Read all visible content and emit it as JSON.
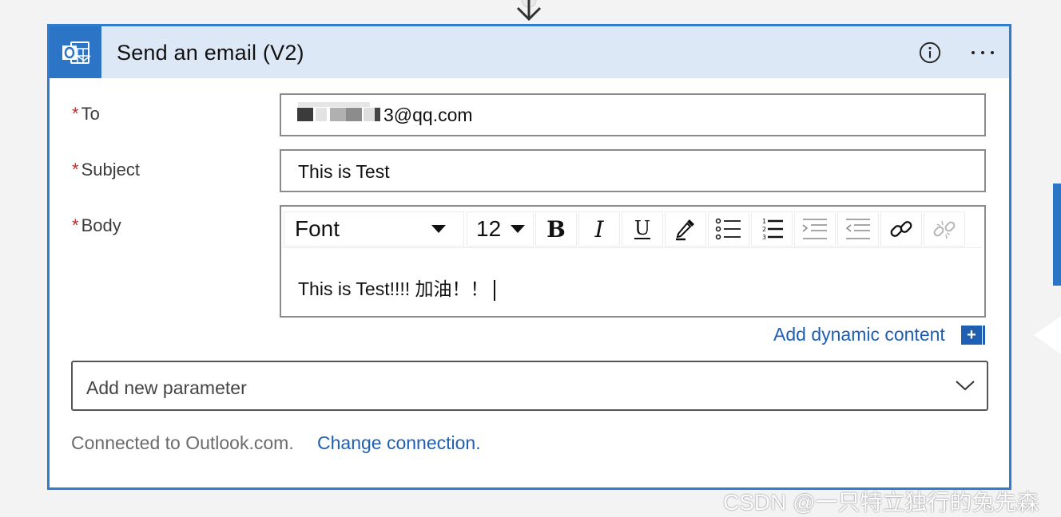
{
  "flow": {
    "connector_icon": "down-arrow-icon"
  },
  "action_card": {
    "title": "Send an email (V2)",
    "app_icon": "outlook-icon",
    "info_icon": "info-icon",
    "more_icon": "more-options-icon",
    "accent_color": "#2b74c6",
    "header_bg": "#dde8f6"
  },
  "fields": {
    "to": {
      "required_mark": "*",
      "label": "To",
      "value_visible": "3@qq.com",
      "redacted": true
    },
    "subject": {
      "required_mark": "*",
      "label": "Subject",
      "value": "This is Test"
    },
    "body": {
      "required_mark": "*",
      "label": "Body",
      "content": "This is Test!!!! 加油！！"
    }
  },
  "editor_toolbar": {
    "font_label": "Font",
    "size_label": "12",
    "buttons": [
      "bold-icon",
      "italic-icon",
      "underline-icon",
      "color-picker-icon",
      "bulleted-list-icon",
      "numbered-list-icon",
      "decrease-indent-icon",
      "increase-indent-icon",
      "insert-link-icon",
      "remove-link-icon"
    ]
  },
  "dynamic_content": {
    "label": "Add dynamic content",
    "plus": "+"
  },
  "parameter": {
    "placeholder": "Add new parameter"
  },
  "connection": {
    "text": "Connected to Outlook.com.",
    "link": "Change connection."
  },
  "watermark": "CSDN @一只特立独行的兔先森"
}
